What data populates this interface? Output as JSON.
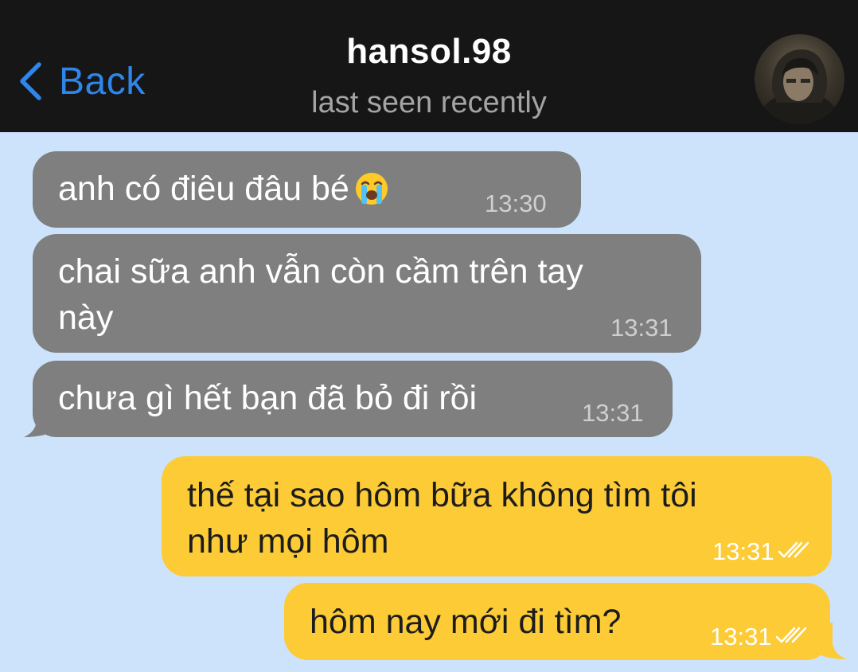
{
  "header": {
    "back_label": "Back",
    "contact_name": "hansol.98",
    "status": "last seen recently"
  },
  "messages": [
    {
      "direction": "incoming",
      "lines": [
        "anh có điêu đâu bé"
      ],
      "emoji": "loudly-crying-face",
      "time": "13:30"
    },
    {
      "direction": "incoming",
      "lines": [
        "chai sữa anh vẫn còn cầm trên tay",
        "này"
      ],
      "time": "13:31"
    },
    {
      "direction": "incoming",
      "lines": [
        "chưa gì hết bạn đã bỏ đi rồi"
      ],
      "time": "13:31"
    },
    {
      "direction": "outgoing",
      "lines": [
        "thế tại sao hôm bữa không tìm tôi",
        "như mọi hôm"
      ],
      "time": "13:31",
      "status": "read"
    },
    {
      "direction": "outgoing",
      "lines": [
        "hôm nay mới đi tìm?"
      ],
      "time": "13:31",
      "status": "read"
    }
  ],
  "colors": {
    "header_bg": "#161616",
    "chat_bg": "#cce3fb",
    "accent": "#2f86ea",
    "incoming_bubble": "#7f7f7f",
    "outgoing_bubble": "#fccb35"
  }
}
